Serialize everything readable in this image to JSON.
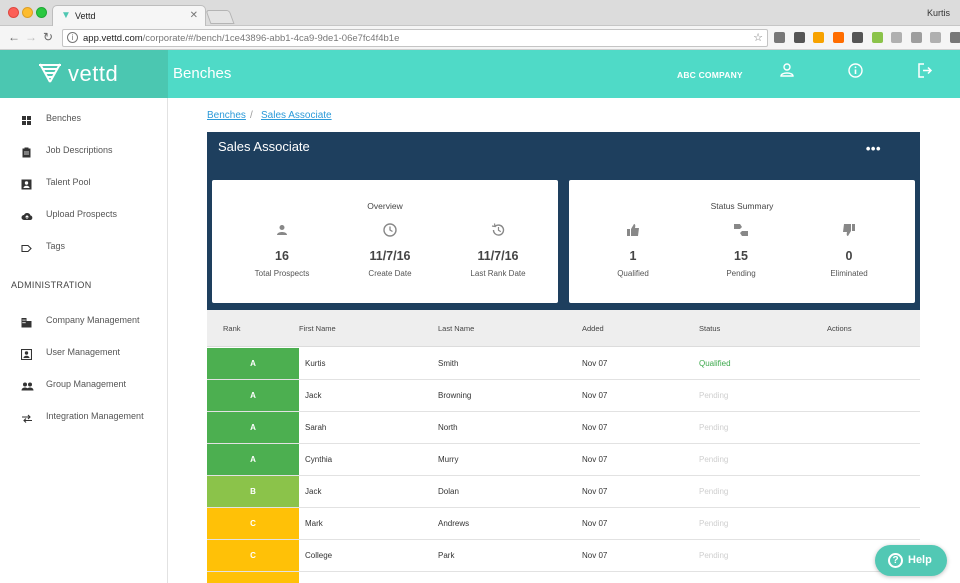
{
  "browser": {
    "tab_title": "Vettd",
    "tab_close": "✕",
    "user": "Kurtis",
    "url_host": "app.vettd.com",
    "url_path": "/corporate/#/bench/1ce43896-abb1-4ca9-9de1-06e7fc4f4b1e",
    "extension_colors": [
      "#777777",
      "#555555",
      "#f7a200",
      "#ff6d00",
      "#555555",
      "#8bc34a",
      "#b0b0b0",
      "#9e9e9e",
      "#b0b0b0",
      "#777777"
    ]
  },
  "header": {
    "brand": "vettd",
    "title": "Benches",
    "company": "ABC COMPANY",
    "accent": "#4fdac7",
    "brand_bg": "#4bc7b1"
  },
  "sidebar": {
    "items": [
      {
        "label": "Benches",
        "icon": "grid-icon"
      },
      {
        "label": "Job Descriptions",
        "icon": "clipboard-icon"
      },
      {
        "label": "Talent Pool",
        "icon": "contact-card-icon"
      },
      {
        "label": "Upload Prospects",
        "icon": "cloud-upload-icon"
      },
      {
        "label": "Tags",
        "icon": "tag-icon"
      }
    ],
    "admin_heading": "ADMINISTRATION",
    "admin_items": [
      {
        "label": "Company Management",
        "icon": "building-icon"
      },
      {
        "label": "User Management",
        "icon": "user-badge-icon"
      },
      {
        "label": "Group Management",
        "icon": "group-icon"
      },
      {
        "label": "Integration Management",
        "icon": "swap-icon"
      }
    ]
  },
  "breadcrumb": {
    "first": "Benches",
    "separator": "/",
    "second": "Sales Associate"
  },
  "panel": {
    "title": "Sales Associate",
    "more": "•••",
    "overview": {
      "title": "Overview",
      "stats": [
        {
          "value": "16",
          "label": "Total Prospects",
          "icon": "person-icon"
        },
        {
          "value": "11/7/16",
          "label": "Create Date",
          "icon": "clock-icon"
        },
        {
          "value": "11/7/16",
          "label": "Last Rank Date",
          "icon": "history-icon"
        }
      ]
    },
    "status_summary": {
      "title": "Status Summary",
      "stats": [
        {
          "value": "1",
          "label": "Qualified",
          "icon": "thumbs-up-icon"
        },
        {
          "value": "15",
          "label": "Pending",
          "icon": "thumbs-sideways-icon"
        },
        {
          "value": "0",
          "label": "Eliminated",
          "icon": "thumbs-down-icon"
        }
      ]
    }
  },
  "table": {
    "headers": {
      "rank": "Rank",
      "first": "First Name",
      "last": "Last Name",
      "added": "Added",
      "status": "Status",
      "actions": "Actions"
    },
    "rank_colors": {
      "A": "#4caf50",
      "B": "#8bc34a",
      "C": "#ffc107"
    },
    "rows": [
      {
        "rank": "A",
        "first": "Kurtis",
        "last": "Smith",
        "added": "Nov 07",
        "status": "Qualified"
      },
      {
        "rank": "A",
        "first": "Jack",
        "last": "Browning",
        "added": "Nov 07",
        "status": "Pending"
      },
      {
        "rank": "A",
        "first": "Sarah",
        "last": "North",
        "added": "Nov 07",
        "status": "Pending"
      },
      {
        "rank": "A",
        "first": "Cynthia",
        "last": "Murry",
        "added": "Nov 07",
        "status": "Pending"
      },
      {
        "rank": "B",
        "first": "Jack",
        "last": "Dolan",
        "added": "Nov 07",
        "status": "Pending"
      },
      {
        "rank": "C",
        "first": "Mark",
        "last": "Andrews",
        "added": "Nov 07",
        "status": "Pending"
      },
      {
        "rank": "C",
        "first": "College",
        "last": "Park",
        "added": "Nov 07",
        "status": "Pending"
      },
      {
        "rank": "C",
        "first": "",
        "last": "",
        "added": "",
        "status": ""
      }
    ]
  },
  "help": {
    "label": "Help",
    "glyph": "?"
  }
}
